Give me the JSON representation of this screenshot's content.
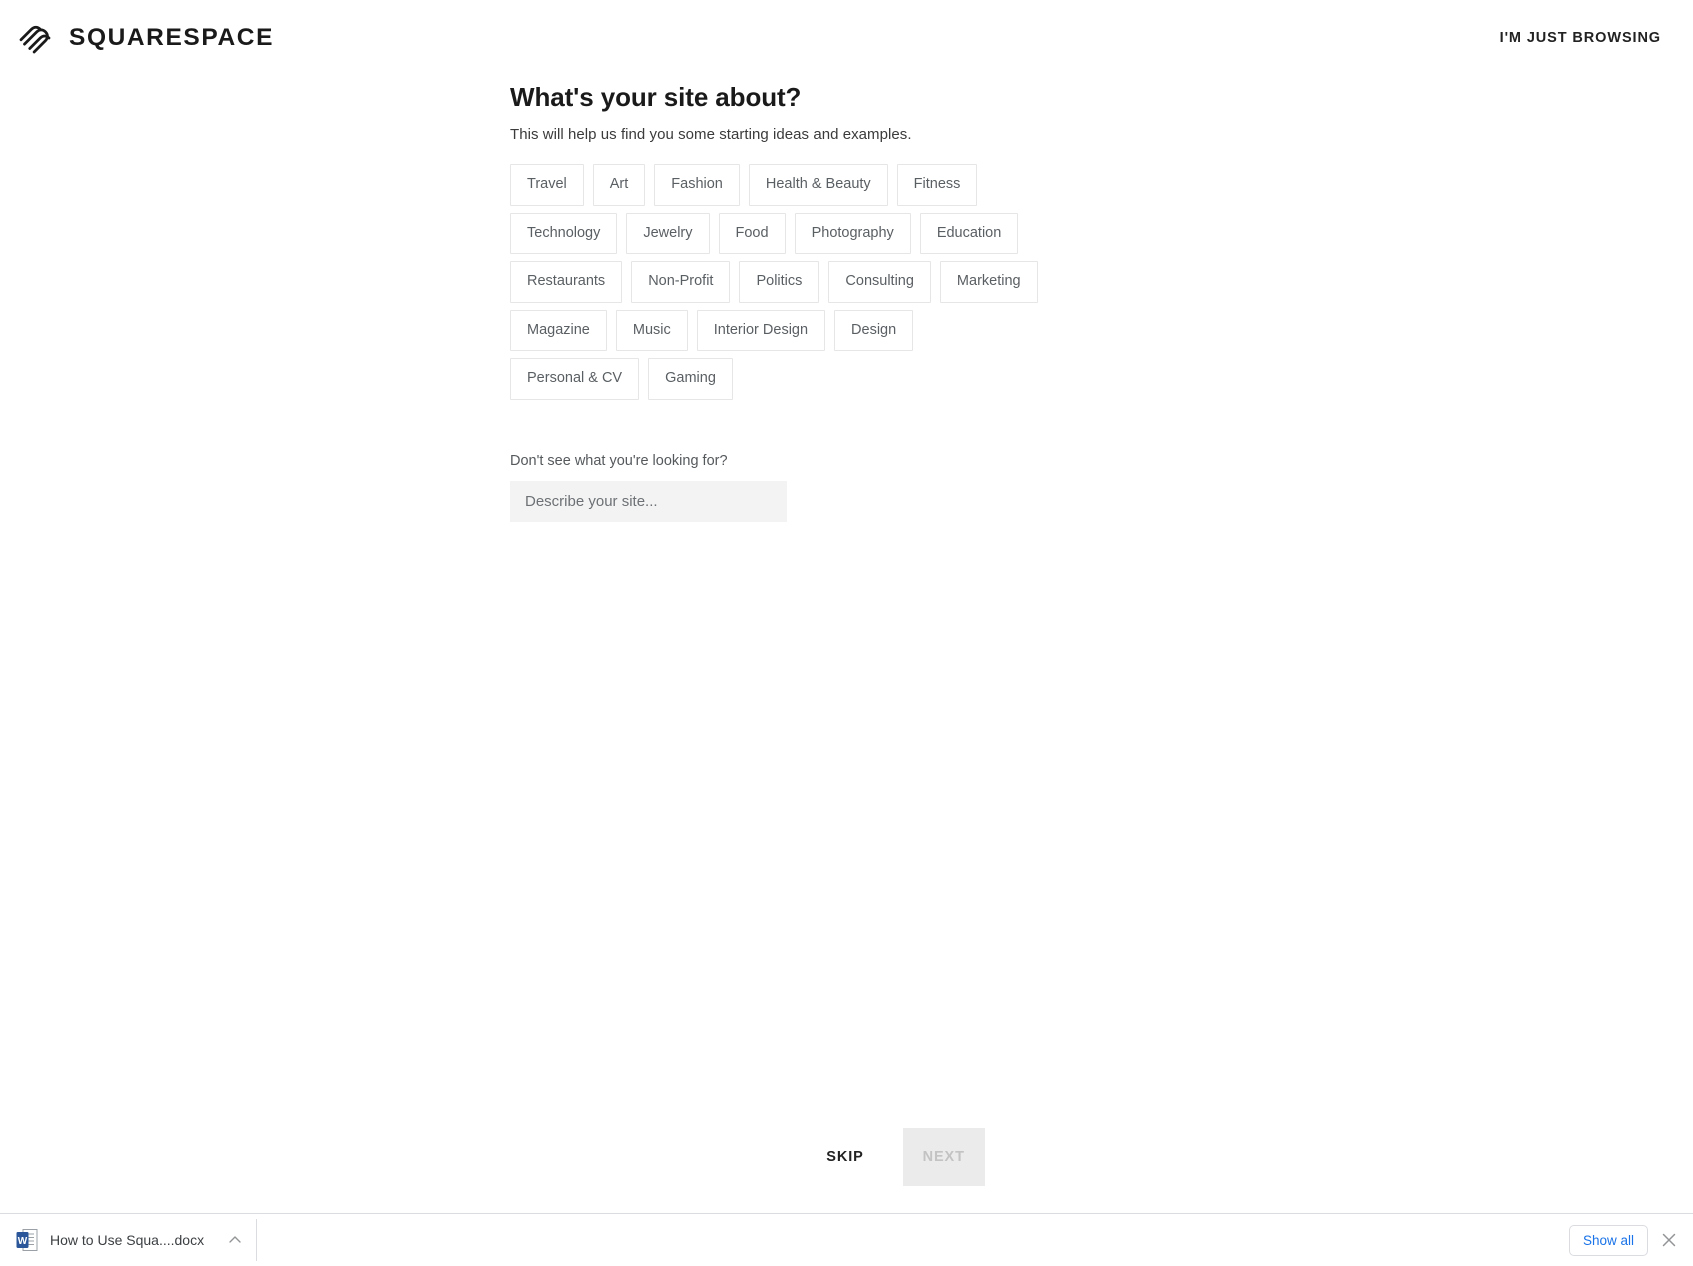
{
  "header": {
    "brand_name": "SQUARESPACE",
    "brand_icon": "squarespace-logo-icon",
    "browsing_link": "I'M JUST BROWSING"
  },
  "main": {
    "title": "What's your site about?",
    "subtitle": "This will help us find you some starting ideas and examples.",
    "categories": [
      "Travel",
      "Art",
      "Fashion",
      "Health & Beauty",
      "Fitness",
      "Technology",
      "Jewelry",
      "Food",
      "Photography",
      "Education",
      "Restaurants",
      "Non-Profit",
      "Politics",
      "Consulting",
      "Marketing",
      "Magazine",
      "Music",
      "Interior Design",
      "Design",
      "Personal & CV",
      "Gaming"
    ],
    "describe_label": "Don't see what you're looking for?",
    "describe_placeholder": "Describe your site...",
    "describe_value": ""
  },
  "actions": {
    "skip_label": "SKIP",
    "next_label": "NEXT",
    "next_disabled": true
  },
  "download_bar": {
    "file_icon": "word-document-icon",
    "file_name": "How to Use Squa....docx",
    "expand_icon": "chevron-up-icon",
    "show_all_label": "Show all",
    "close_icon": "close-icon"
  },
  "colors": {
    "accent_link": "#1a73e8",
    "chip_border": "#e6e6e6",
    "input_background": "#f3f3f3",
    "next_background": "#ebebeb",
    "next_text": "#c3c3c3"
  }
}
